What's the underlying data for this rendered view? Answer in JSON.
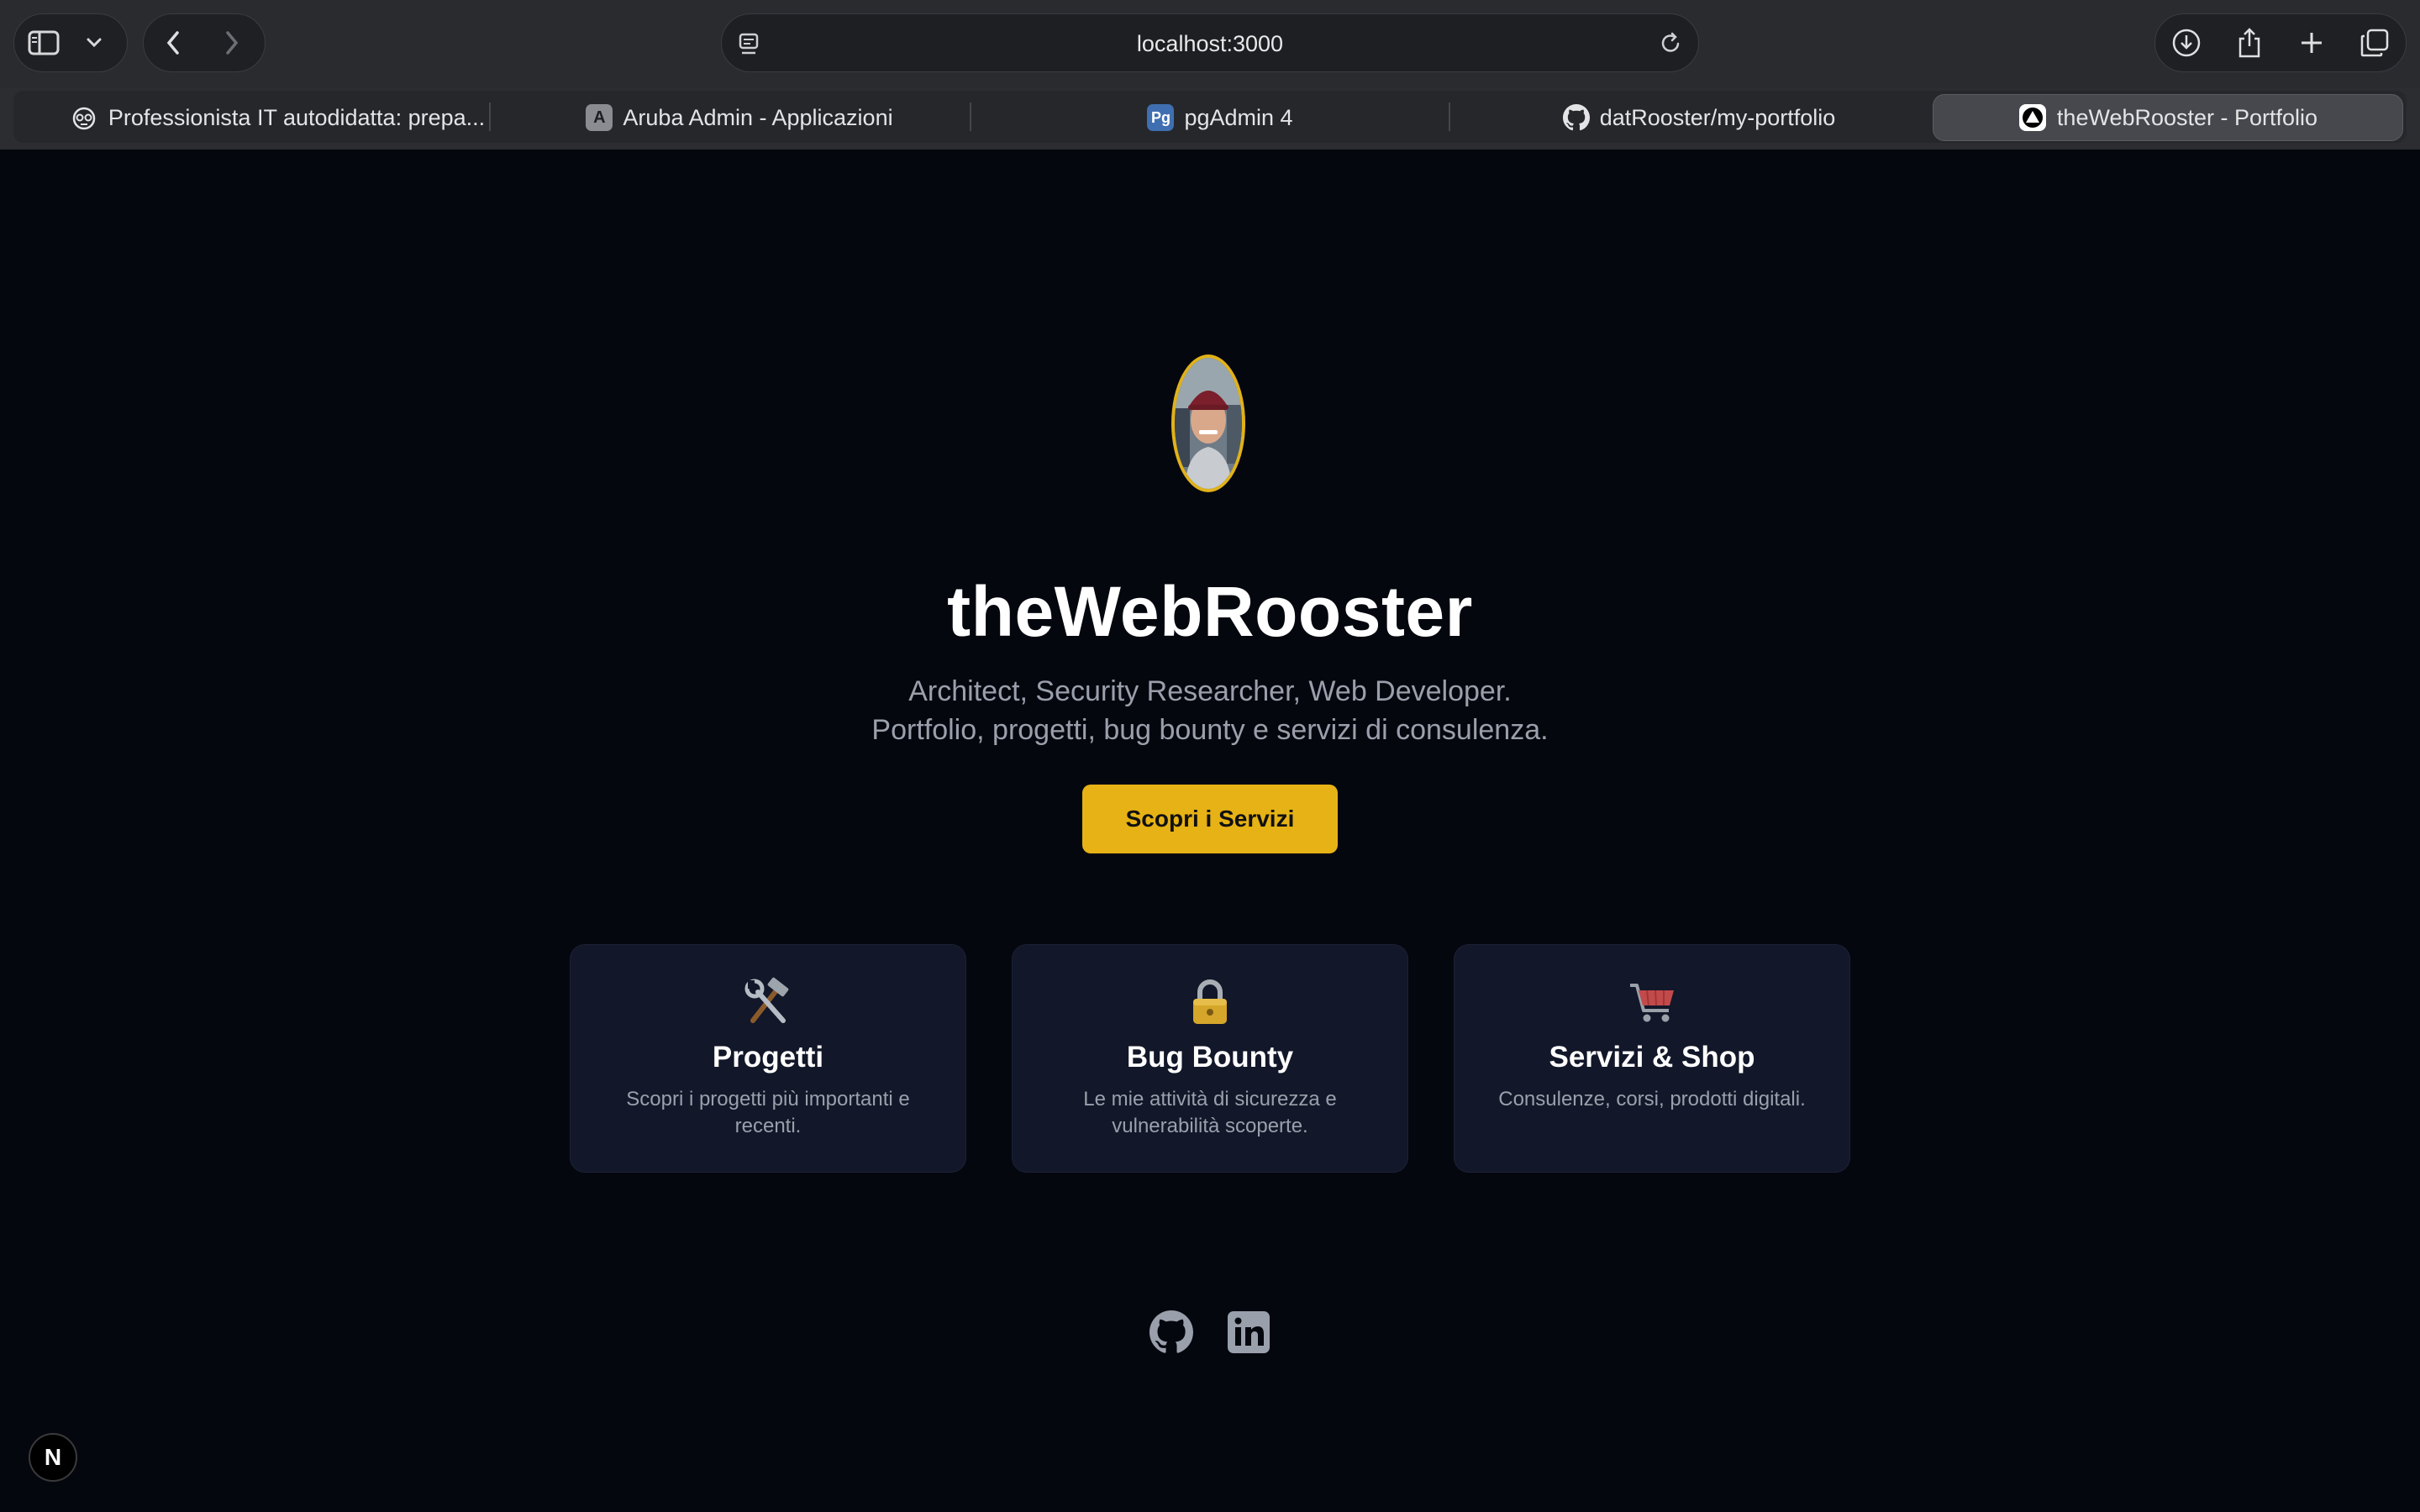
{
  "browser": {
    "url": "localhost:3000",
    "tabs": [
      {
        "label": "Professionista IT autodidatta: prepa...",
        "icon": "copilot-icon",
        "active": false
      },
      {
        "label": "Aruba Admin - Applicazioni",
        "icon": "aruba-icon",
        "favicon_text": "A",
        "active": false
      },
      {
        "label": "pgAdmin 4",
        "icon": "pgadmin-icon",
        "favicon_text": "Pg",
        "active": false
      },
      {
        "label": "datRooster/my-portfolio",
        "icon": "github-icon",
        "active": false
      },
      {
        "label": "theWebRooster - Portfolio",
        "icon": "vercel-icon",
        "active": true
      }
    ]
  },
  "hero": {
    "title": "theWebRooster",
    "subtitle_line1": "Architect, Security Researcher, Web Developer.",
    "subtitle_line2": "Portfolio, progetti, bug bounty e servizi di consulenza.",
    "cta_label": "Scopri i Servizi",
    "accent_color": "#e6b215"
  },
  "cards": [
    {
      "icon": "hammer-wrench-icon",
      "title": "Progetti",
      "description": "Scopri i progetti più importanti e recenti."
    },
    {
      "icon": "lock-icon",
      "title": "Bug Bounty",
      "description": "Le mie attività di sicurezza e vulnerabilità scoperte."
    },
    {
      "icon": "shopping-cart-icon",
      "title": "Servizi & Shop",
      "description": "Consulenze, corsi, prodotti digitali."
    }
  ],
  "social": [
    {
      "icon": "github-icon"
    },
    {
      "icon": "linkedin-icon"
    }
  ],
  "dev_badge": {
    "label": "N",
    "icon": "nextjs-icon"
  }
}
